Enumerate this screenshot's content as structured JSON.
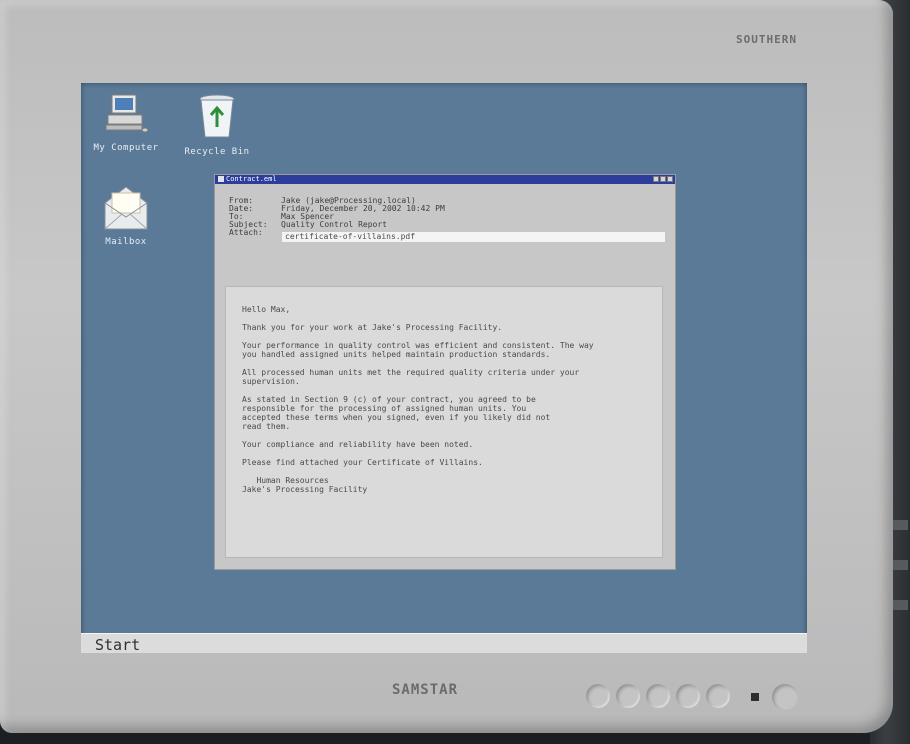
{
  "monitor": {
    "brand_top": "SOUTHERN",
    "brand_bottom": "SAMSTAR"
  },
  "desktop": {
    "icons": [
      {
        "label": "My Computer",
        "icon": "computer-icon"
      },
      {
        "label": "Recycle Bin",
        "icon": "recycle-bin-icon"
      },
      {
        "label": "Mailbox",
        "icon": "mail-envelope-icon"
      }
    ]
  },
  "window": {
    "title": "Contract.eml",
    "headers": [
      {
        "label": "From:",
        "value": "Jake (jake@Processing.local)"
      },
      {
        "label": "Date:",
        "value": "Friday, December 20, 2002 10:42 PM"
      },
      {
        "label": "To:",
        "value": "Max Spencer"
      },
      {
        "label": "Subject:",
        "value": "Quality Control Report"
      },
      {
        "label": "Attach:",
        "value": "certificate-of-villains.pdf"
      }
    ],
    "body": [
      "Hello Max,",
      "Thank you for your work at Jake's Processing Facility.",
      "Your performance in quality control was efficient and consistent. The way\nyou handled assigned units helped maintain production standards.",
      "All processed human units met the required quality criteria under your\nsupervision.",
      "As stated in Section 9 (c) of your contract, you agreed to be\nresponsible for the processing of assigned human units. You\naccepted these terms when you signed, even if you likely did not\nread them.",
      "Your compliance and reliability have been noted.",
      "Please find attached your Certificate of Villains.",
      "   Human Resources\nJake's Processing Facility"
    ]
  },
  "taskbar": {
    "start_label": "Start"
  },
  "colors": {
    "desktop": "#5a7a98",
    "titlebar": "#2d3d9c",
    "window": "#c7c7c7",
    "taskbar": "#dcdcdc"
  }
}
